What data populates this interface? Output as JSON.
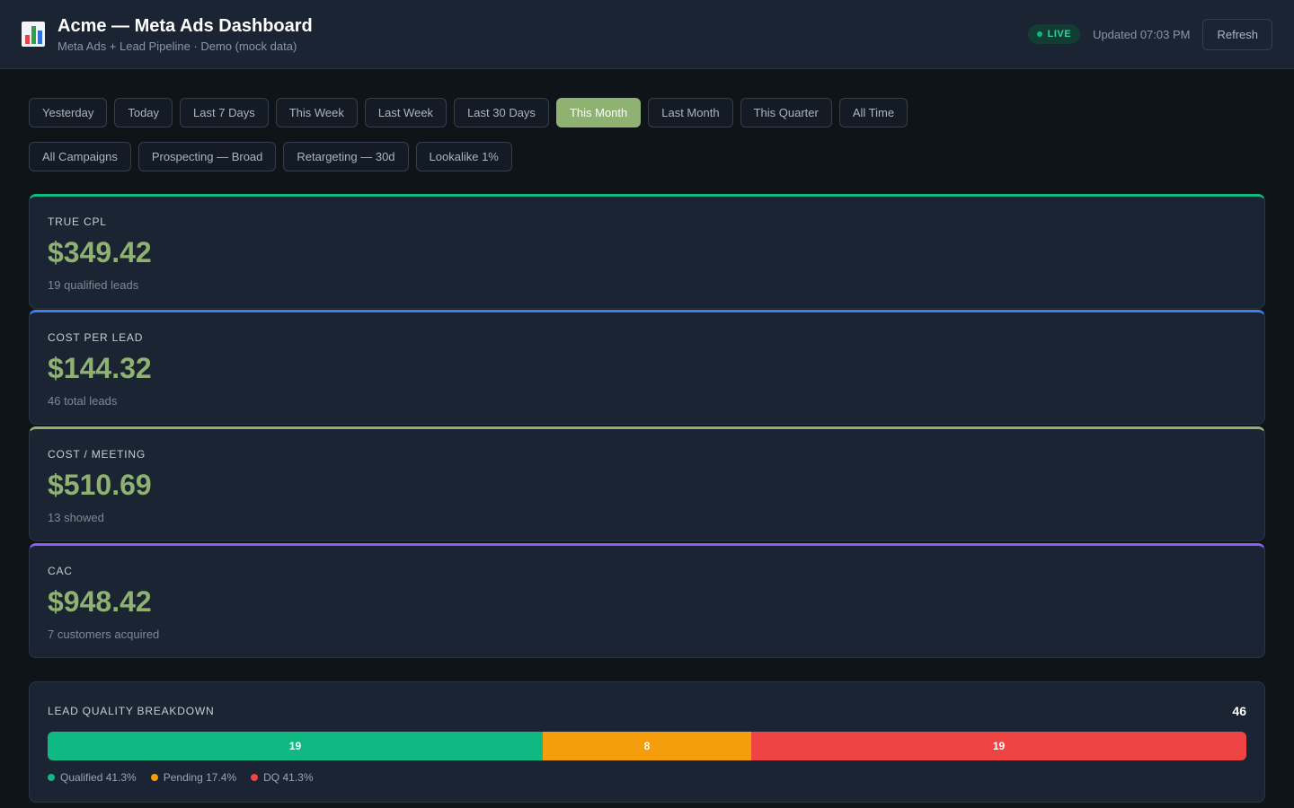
{
  "header": {
    "title": "Acme — Meta Ads Dashboard",
    "subtitle": "Meta Ads + Lead Pipeline · Demo (mock data)",
    "live_label": "LIVE",
    "updated": "Updated 07:03 PM",
    "refresh_label": "Refresh",
    "logo_icon": "bar-chart-icon"
  },
  "date_filters": [
    {
      "label": "Yesterday",
      "active": false
    },
    {
      "label": "Today",
      "active": false
    },
    {
      "label": "Last 7 Days",
      "active": false
    },
    {
      "label": "This Week",
      "active": false
    },
    {
      "label": "Last Week",
      "active": false
    },
    {
      "label": "Last 30 Days",
      "active": false
    },
    {
      "label": "This Month",
      "active": true
    },
    {
      "label": "Last Month",
      "active": false
    },
    {
      "label": "This Quarter",
      "active": false
    },
    {
      "label": "All Time",
      "active": false
    }
  ],
  "campaign_filters": [
    {
      "label": "All Campaigns",
      "active": false
    },
    {
      "label": "Prospecting — Broad",
      "active": false
    },
    {
      "label": "Retargeting — 30d",
      "active": false
    },
    {
      "label": "Lookalike 1%",
      "active": false
    }
  ],
  "kpis": [
    {
      "label": "TRUE CPL",
      "value": "$349.42",
      "sub": "19 qualified leads",
      "accent": "#10b981"
    },
    {
      "label": "COST PER LEAD",
      "value": "$144.32",
      "sub": "46 total leads",
      "accent": "#3b82f6"
    },
    {
      "label": "COST / MEETING",
      "value": "$510.69",
      "sub": "13 showed",
      "accent": "#8fb273"
    },
    {
      "label": "CAC",
      "value": "$948.42",
      "sub": "7 customers acquired",
      "accent": "#8b5cf6"
    }
  ],
  "lead_quality": {
    "title": "LEAD QUALITY BREAKDOWN",
    "total": "46",
    "segments": [
      {
        "name": "Qualified",
        "count": 19,
        "label": "19",
        "legend": "Qualified 41.3%",
        "color": "#10b981"
      },
      {
        "name": "Pending",
        "count": 8,
        "label": "8",
        "legend": "Pending 17.4%",
        "color": "#f59e0b"
      },
      {
        "name": "DQ",
        "count": 19,
        "label": "19",
        "legend": "DQ 41.3%",
        "color": "#ef4444"
      }
    ]
  },
  "colors": {
    "background": "#0f1419",
    "panel": "#1b2432",
    "accent_green": "#8fb273",
    "live_green": "#10b981"
  }
}
